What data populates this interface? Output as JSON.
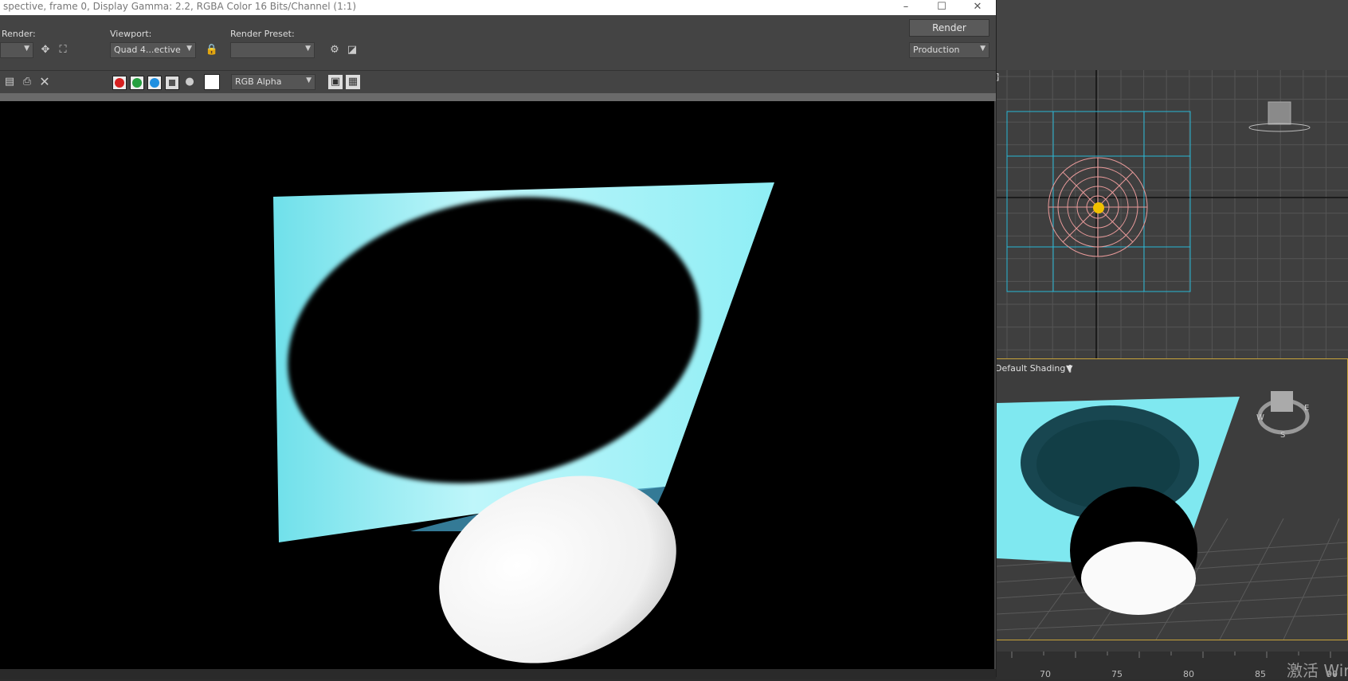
{
  "window": {
    "title": "spective, frame 0, Display Gamma: 2.2, RGBA Color 16 Bits/Channel (1:1)",
    "minimize": "–",
    "maximize": "☐",
    "close": "✕"
  },
  "controls": {
    "render_label": "Render:",
    "viewport_label": "Viewport:",
    "viewport_value": "Quad 4...ective",
    "preset_label": "Render Preset:",
    "preset_value": "",
    "render_button": "Render",
    "production_value": "Production"
  },
  "toolbar2": {
    "channel_value": "RGB Alpha"
  },
  "viewports": {
    "persp_label": "Default Shading ]",
    "top_label": "]"
  },
  "timeline": {
    "ticks": [
      "70",
      "75",
      "80",
      "85",
      "90"
    ]
  },
  "watermark": "激活 Wir",
  "colors": {
    "accent_border": "#c8a33a",
    "plane_cyan": "#7fe8f0"
  }
}
